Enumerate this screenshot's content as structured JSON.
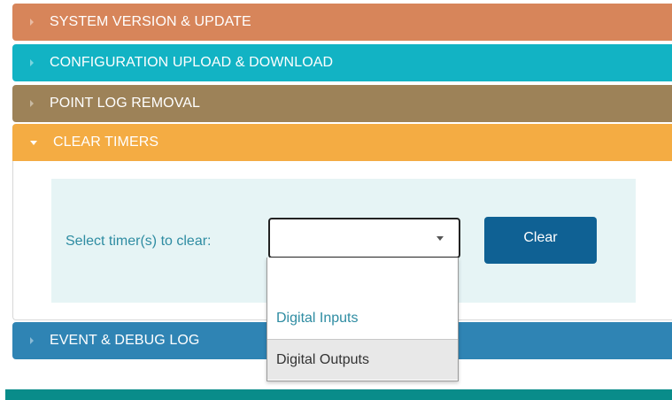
{
  "sections": {
    "system_version": "SYSTEM VERSION & UPDATE",
    "config_upload": "CONFIGURATION UPLOAD & DOWNLOAD",
    "point_log": "POINT LOG REMOVAL",
    "clear_timers": "CLEAR TIMERS",
    "event_debug": "EVENT & DEBUG LOG"
  },
  "colors": {
    "system_version": "#d7855a",
    "config_upload": "#12b3c4",
    "point_log": "#9d8258",
    "clear_timers": "#f4ac43",
    "event_debug": "#2f84b4",
    "button": "#0f6194",
    "footer": "#098c8a"
  },
  "clear_timers": {
    "select_label": "Select timer(s) to clear:",
    "selected_value": "",
    "options": [
      "",
      "Digital Inputs",
      "Digital Outputs"
    ],
    "button_label": "Clear"
  }
}
